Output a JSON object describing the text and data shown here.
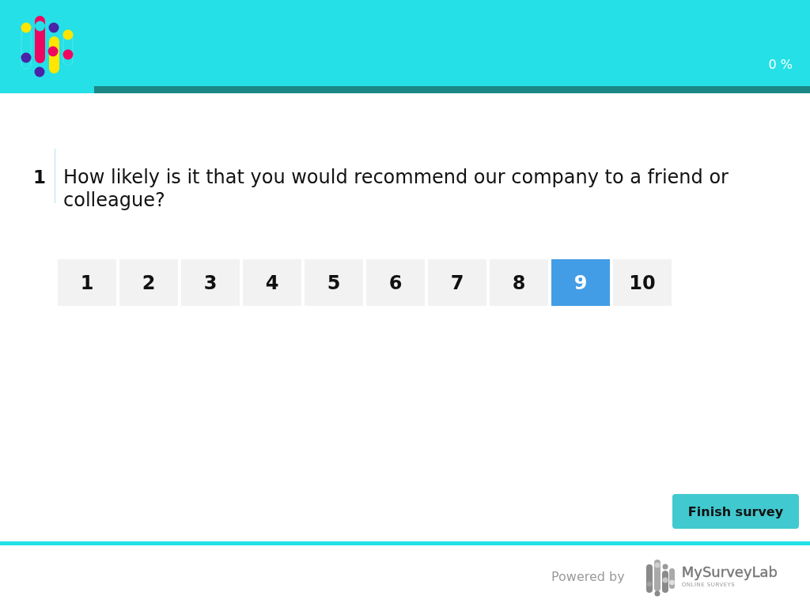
{
  "header": {
    "progress": {
      "level": 0,
      "reading": "0 %"
    }
  },
  "question": {
    "number": "1",
    "text": "How likely is it that you would recommend our company to a friend or colleague?",
    "scale": [
      {
        "label": "1",
        "selected": false
      },
      {
        "label": "2",
        "selected": false
      },
      {
        "label": "3",
        "selected": false
      },
      {
        "label": "4",
        "selected": false
      },
      {
        "label": "5",
        "selected": false
      },
      {
        "label": "6",
        "selected": false
      },
      {
        "label": "7",
        "selected": false
      },
      {
        "label": "8",
        "selected": false
      },
      {
        "label": "9",
        "selected": true
      },
      {
        "label": "10",
        "selected": false
      }
    ]
  },
  "finish_button": "Finish survey",
  "footer": {
    "powered_by": "Powered by",
    "brand": {
      "name": "MySurveyLab",
      "tagline": "ONLINE SURVEYS"
    }
  }
}
